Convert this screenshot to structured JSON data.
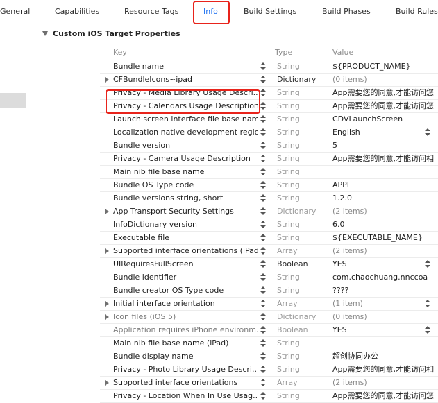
{
  "tabs": [
    "General",
    "Capabilities",
    "Resource Tags",
    "Info",
    "Build Settings",
    "Build Phases",
    "Build Rules"
  ],
  "section": {
    "title": "Custom iOS Target Properties"
  },
  "columns": {
    "key": "Key",
    "type": "Type",
    "value": "Value"
  },
  "rows": [
    {
      "key": "Bundle name",
      "type": "String",
      "value": "${PRODUCT_NAME}"
    },
    {
      "key": "CFBundleIcons~ipad",
      "type": "Dictionary",
      "value": "(0 items)"
    },
    {
      "key": "Privacy - Media Library Usage Descri...",
      "type": "String",
      "value": "App需要您的同意,才能访问您"
    },
    {
      "key": "Privacy - Calendars Usage Description",
      "type": "String",
      "value": "App需要您的同意,才能访问您"
    },
    {
      "key": "Launch screen interface file base name",
      "type": "String",
      "value": "CDVLaunchScreen"
    },
    {
      "key": "Localization native development region",
      "type": "String",
      "value": "English"
    },
    {
      "key": "Bundle version",
      "type": "String",
      "value": "5"
    },
    {
      "key": "Privacy - Camera Usage Description",
      "type": "String",
      "value": "App需要您的同意,才能访问相"
    },
    {
      "key": "Main nib file base name",
      "type": "String",
      "value": ""
    },
    {
      "key": "Bundle OS Type code",
      "type": "String",
      "value": "APPL"
    },
    {
      "key": "Bundle versions string, short",
      "type": "String",
      "value": "1.2.0"
    },
    {
      "key": "App Transport Security Settings",
      "type": "Dictionary",
      "value": "(2 items)"
    },
    {
      "key": "InfoDictionary version",
      "type": "String",
      "value": "6.0"
    },
    {
      "key": "Executable file",
      "type": "String",
      "value": "${EXECUTABLE_NAME}"
    },
    {
      "key": "Supported interface orientations (iPad)",
      "type": "Array",
      "value": "(2 items)"
    },
    {
      "key": "UIRequiresFullScreen",
      "type": "Boolean",
      "value": "YES"
    },
    {
      "key": "Bundle identifier",
      "type": "String",
      "value": "com.chaochuang.nnccoa"
    },
    {
      "key": "Bundle creator OS Type code",
      "type": "String",
      "value": "????"
    },
    {
      "key": "Initial interface orientation",
      "type": "Array",
      "value": "(1 item)"
    },
    {
      "key": "Icon files (iOS 5)",
      "type": "Dictionary",
      "value": "(0 items)"
    },
    {
      "key": "Application requires iPhone environm...",
      "type": "Boolean",
      "value": "YES"
    },
    {
      "key": "Main nib file base name (iPad)",
      "type": "String",
      "value": ""
    },
    {
      "key": "Bundle display name",
      "type": "String",
      "value": "超创协同办公"
    },
    {
      "key": "Privacy - Photo Library Usage Descri...",
      "type": "String",
      "value": "App需要您的同意,才能访问相"
    },
    {
      "key": "Supported interface orientations",
      "type": "Array",
      "value": "(2 items)"
    },
    {
      "key": "Privacy - Location When In Use Usag...",
      "type": "String",
      "value": "App需要您的同意,才能访问您"
    }
  ]
}
